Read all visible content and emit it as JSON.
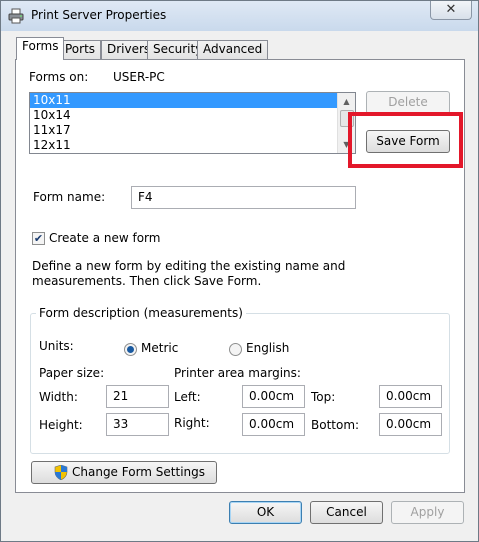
{
  "window": {
    "title": "Print Server Properties",
    "close_glyph": "✕"
  },
  "tabs": [
    {
      "label": "Forms",
      "active": true
    },
    {
      "label": "Ports",
      "active": false
    },
    {
      "label": "Drivers",
      "active": false
    },
    {
      "label": "Security",
      "active": false
    },
    {
      "label": "Advanced",
      "active": false
    }
  ],
  "forms_on": {
    "label": "Forms on:",
    "value": "USER-PC"
  },
  "forms_list": {
    "items": [
      "10x11",
      "10x14",
      "11x17",
      "12x11"
    ],
    "selected_index": 0
  },
  "buttons": {
    "delete": "Delete",
    "save_form": "Save Form",
    "change_settings": "Change Form Settings",
    "ok": "OK",
    "cancel": "Cancel",
    "apply": "Apply"
  },
  "form_name": {
    "label": "Form name:",
    "value": "F4"
  },
  "create_new": {
    "label": "Create a new form",
    "checked": true
  },
  "instructions": {
    "line1": "Define a new form by editing the existing name and",
    "line2": "measurements. Then click Save Form."
  },
  "form_description": {
    "legend": "Form description (measurements)",
    "units_label": "Units:",
    "metric_label": "Metric",
    "english_label": "English",
    "selected_unit": "Metric",
    "paper_size_label": "Paper size:",
    "margins_label": "Printer area margins:",
    "width_label": "Width:",
    "width_value": "21",
    "height_label": "Height:",
    "height_value": "33",
    "left_label": "Left:",
    "left_value": "0.00cm",
    "right_label": "Right:",
    "right_value": "0.00cm",
    "top_label": "Top:",
    "top_value": "0.00cm",
    "bottom_label": "Bottom:",
    "bottom_value": "0.00cm"
  },
  "colors": {
    "highlight": "#e3172a",
    "selection": "#3399ff"
  }
}
